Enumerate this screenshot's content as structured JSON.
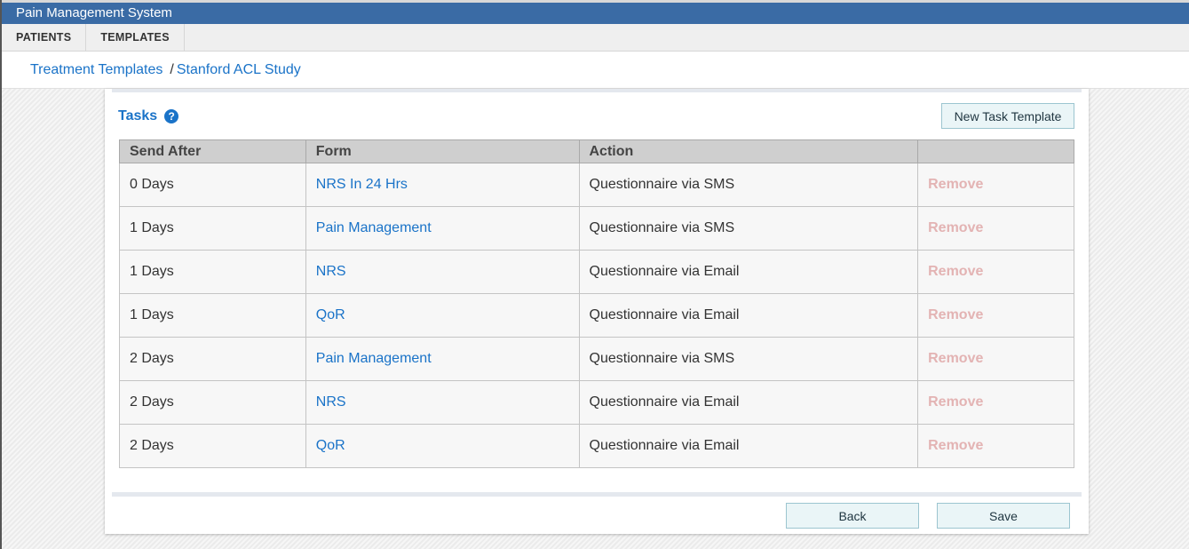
{
  "app": {
    "title": "Pain Management System"
  },
  "nav": {
    "items": [
      {
        "label": "PATIENTS"
      },
      {
        "label": "TEMPLATES"
      }
    ]
  },
  "breadcrumb": {
    "parent": "Treatment Templates",
    "separator": "/",
    "current": "Stanford ACL Study"
  },
  "tasks": {
    "title": "Tasks",
    "help_icon": "?",
    "new_button_label": "New Task Template",
    "columns": [
      "Send After",
      "Form",
      "Action",
      ""
    ],
    "rows": [
      {
        "send_after": "0 Days",
        "form": "NRS In 24 Hrs",
        "action": "Questionnaire via SMS",
        "remove": "Remove"
      },
      {
        "send_after": "1 Days",
        "form": "Pain Management",
        "action": "Questionnaire via SMS",
        "remove": "Remove"
      },
      {
        "send_after": "1 Days",
        "form": "NRS",
        "action": "Questionnaire via Email",
        "remove": "Remove"
      },
      {
        "send_after": "1 Days",
        "form": "QoR",
        "action": "Questionnaire via Email",
        "remove": "Remove"
      },
      {
        "send_after": "2 Days",
        "form": "Pain Management",
        "action": "Questionnaire via SMS",
        "remove": "Remove"
      },
      {
        "send_after": "2 Days",
        "form": "NRS",
        "action": "Questionnaire via Email",
        "remove": "Remove"
      },
      {
        "send_after": "2 Days",
        "form": "QoR",
        "action": "Questionnaire via Email",
        "remove": "Remove"
      }
    ]
  },
  "footer": {
    "back_label": "Back",
    "save_label": "Save"
  },
  "colors": {
    "titlebar": "#3a6ba5",
    "link": "#1a73c8",
    "remove": "#e3b3b3",
    "button_bg": "#eaf5f7"
  }
}
